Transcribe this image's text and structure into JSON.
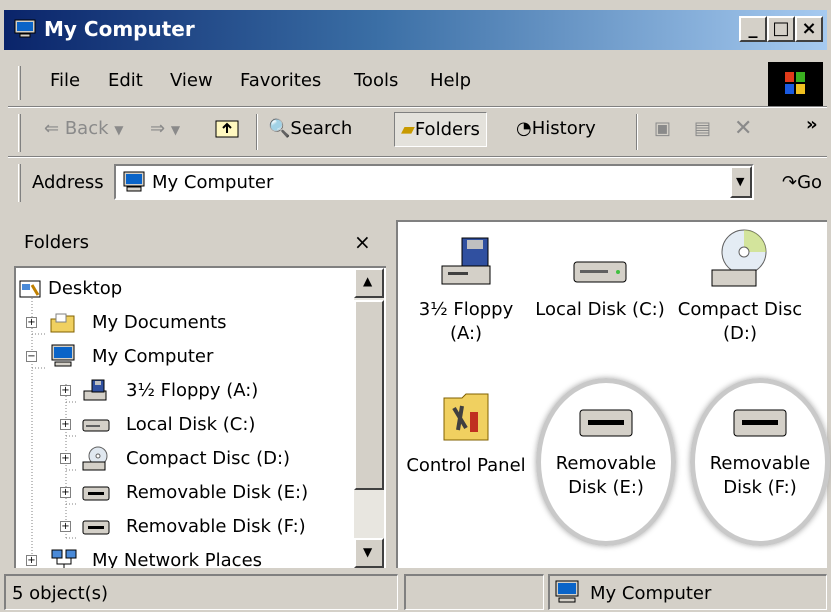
{
  "window": {
    "title": "My Computer"
  },
  "menu": {
    "items": [
      "File",
      "Edit",
      "View",
      "Favorites",
      "Tools",
      "Help"
    ]
  },
  "toolbar": {
    "back": "Back",
    "search": "Search",
    "folders": "Folders",
    "history": "History",
    "more": "»"
  },
  "address": {
    "label": "Address",
    "value": "My Computer",
    "go": "Go"
  },
  "folders_pane": {
    "title": "Folders",
    "close": "×",
    "tree": [
      {
        "label": "Desktop",
        "icon": "desktop-icon"
      },
      {
        "label": "My Documents",
        "icon": "folder-icon"
      },
      {
        "label": "My Computer",
        "icon": "computer-icon"
      },
      {
        "label": "3½ Floppy (A:)",
        "icon": "floppy-icon"
      },
      {
        "label": "Local Disk (C:)",
        "icon": "hard-disk-icon"
      },
      {
        "label": "Compact Disc (D:)",
        "icon": "cd-icon"
      },
      {
        "label": "Removable Disk (E:)",
        "icon": "removable-disk-icon"
      },
      {
        "label": "Removable Disk (F:)",
        "icon": "removable-disk-icon"
      },
      {
        "label": "My Network Places",
        "icon": "network-icon"
      }
    ]
  },
  "content": {
    "items": [
      {
        "name_line1": "3½ Floppy",
        "name_line2": "(A:)",
        "icon": "floppy-drive-icon"
      },
      {
        "name_line1": "Local Disk (C:)",
        "name_line2": "",
        "icon": "hard-disk-icon"
      },
      {
        "name_line1": "Compact Disc",
        "name_line2": "(D:)",
        "icon": "cd-drive-icon"
      },
      {
        "name_line1": "Control Panel",
        "name_line2": "",
        "icon": "control-panel-icon"
      },
      {
        "name_line1": "Removable",
        "name_line2": "Disk (E:)",
        "icon": "removable-disk-icon",
        "highlighted": true
      },
      {
        "name_line1": "Removable",
        "name_line2": "Disk (F:)",
        "icon": "removable-disk-icon",
        "highlighted": true
      }
    ]
  },
  "status": {
    "objects": "5 object(s)",
    "zone": "My Computer"
  },
  "colors": {
    "titlebar_start": "#0a246a",
    "titlebar_end": "#a6caf0",
    "face": "#d4d0c8",
    "highlight_ring": "#c9c9c9"
  }
}
